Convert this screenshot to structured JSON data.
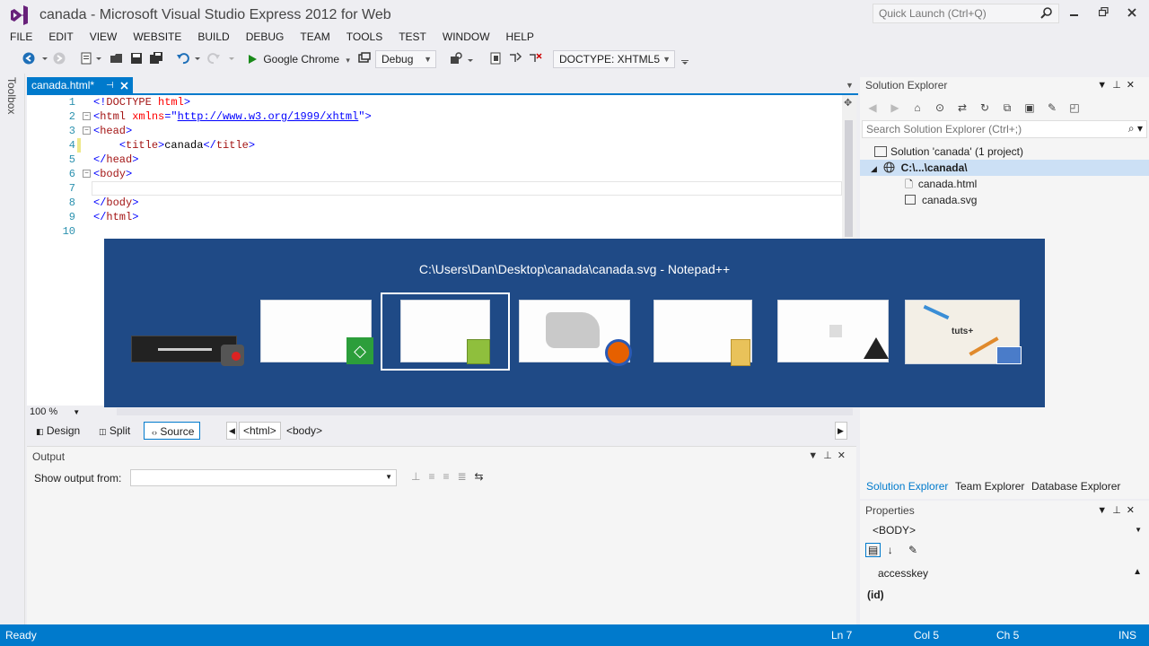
{
  "window": {
    "title": "canada - Microsoft Visual Studio Express 2012 for Web",
    "quick_launch_placeholder": "Quick Launch (Ctrl+Q)"
  },
  "menu": [
    "FILE",
    "EDIT",
    "VIEW",
    "WEBSITE",
    "BUILD",
    "DEBUG",
    "TEAM",
    "TOOLS",
    "TEST",
    "WINDOW",
    "HELP"
  ],
  "toolbar": {
    "run_target": "Google Chrome",
    "configuration": "Debug",
    "doctype": "DOCTYPE: XHTML5"
  },
  "toolbox_label": "Toolbox",
  "editor": {
    "tab_label": "canada.html*",
    "zoom": "100 %",
    "lines": [
      {
        "n": "1",
        "fold": "",
        "segments": [
          {
            "c": "br",
            "t": "<!"
          },
          {
            "c": "tag",
            "t": "DOCTYPE"
          },
          {
            "c": "txt",
            "t": " "
          },
          {
            "c": "attr",
            "t": "html"
          },
          {
            "c": "br",
            "t": ">"
          }
        ]
      },
      {
        "n": "2",
        "fold": "−",
        "segments": [
          {
            "c": "br",
            "t": "<"
          },
          {
            "c": "tag",
            "t": "html"
          },
          {
            "c": "txt",
            "t": " "
          },
          {
            "c": "attr",
            "t": "xmlns"
          },
          {
            "c": "br",
            "t": "=\""
          },
          {
            "c": "val",
            "t": "http://www.w3.org/1999/xhtml"
          },
          {
            "c": "br",
            "t": "\">"
          }
        ]
      },
      {
        "n": "3",
        "fold": "−",
        "segments": [
          {
            "c": "br",
            "t": "<"
          },
          {
            "c": "tag",
            "t": "head"
          },
          {
            "c": "br",
            "t": ">"
          }
        ]
      },
      {
        "n": "4",
        "fold": "",
        "segments": [
          {
            "c": "txt",
            "t": "    "
          },
          {
            "c": "br",
            "t": "<"
          },
          {
            "c": "tag",
            "t": "title"
          },
          {
            "c": "br",
            "t": ">"
          },
          {
            "c": "txt",
            "t": "canada"
          },
          {
            "c": "br",
            "t": "</"
          },
          {
            "c": "tag",
            "t": "title"
          },
          {
            "c": "br",
            "t": ">"
          }
        ]
      },
      {
        "n": "5",
        "fold": "",
        "segments": [
          {
            "c": "br",
            "t": "</"
          },
          {
            "c": "tag",
            "t": "head"
          },
          {
            "c": "br",
            "t": ">"
          }
        ]
      },
      {
        "n": "6",
        "fold": "−",
        "segments": [
          {
            "c": "br",
            "t": "<"
          },
          {
            "c": "tag",
            "t": "body"
          },
          {
            "c": "br",
            "t": ">"
          }
        ]
      },
      {
        "n": "7",
        "fold": "",
        "segments": []
      },
      {
        "n": "8",
        "fold": "",
        "segments": [
          {
            "c": "br",
            "t": "</"
          },
          {
            "c": "tag",
            "t": "body"
          },
          {
            "c": "br",
            "t": ">"
          }
        ]
      },
      {
        "n": "9",
        "fold": "",
        "segments": [
          {
            "c": "br",
            "t": "</"
          },
          {
            "c": "tag",
            "t": "html"
          },
          {
            "c": "br",
            "t": ">"
          }
        ]
      },
      {
        "n": "10",
        "fold": "",
        "segments": []
      }
    ],
    "views": {
      "design": "Design",
      "split": "Split",
      "source": "Source"
    },
    "breadcrumbs": [
      "<html>",
      "<body>"
    ]
  },
  "alt_tab": {
    "title": "C:\\Users\\Dan\\Desktop\\canada\\canada.svg - Notepad++"
  },
  "output": {
    "title": "Output",
    "show_from_label": "Show output from:",
    "show_from_value": ""
  },
  "solution_explorer": {
    "title": "Solution Explorer",
    "search_placeholder": "Search Solution Explorer (Ctrl+;)",
    "solution": "Solution 'canada' (1 project)",
    "project": "C:\\...\\canada\\",
    "files": [
      "canada.html",
      "canada.svg"
    ],
    "tabs": [
      "Solution Explorer",
      "Team Explorer",
      "Database Explorer"
    ]
  },
  "properties": {
    "title": "Properties",
    "object": "<BODY>",
    "rows": [
      "accesskey",
      "(id)"
    ]
  },
  "status": {
    "state": "Ready",
    "ln": "Ln 7",
    "col": "Col 5",
    "ch": "Ch 5",
    "mode": "INS"
  },
  "colors": {
    "accent": "#007acc",
    "alt_tab_bg": "#1f4a86"
  }
}
